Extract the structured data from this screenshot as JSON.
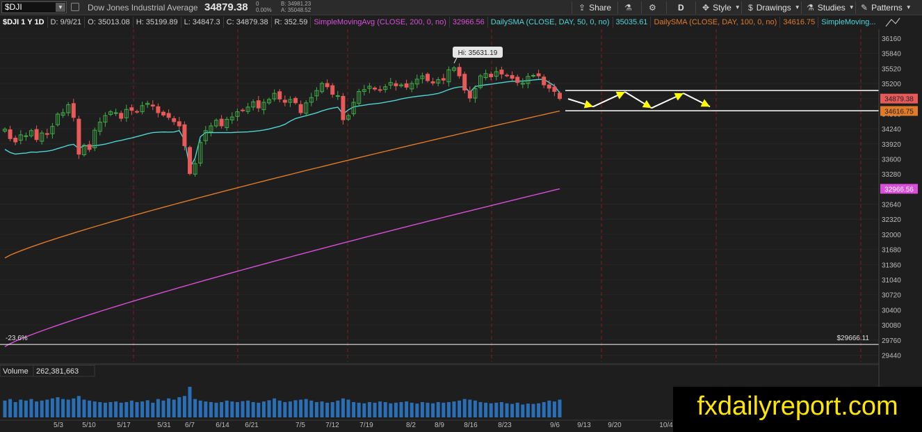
{
  "toolbar": {
    "symbol": "$DJI",
    "name": "Dow Jones Industrial Average",
    "last": "34879.38",
    "change": "0",
    "change_pct": "0.00%",
    "bid": "B: 34981.23",
    "ask": "A: 35048.52",
    "share_label": "Share",
    "aggregation": "D",
    "style_label": "Style",
    "drawings_label": "Drawings",
    "studies_label": "Studies",
    "patterns_label": "Patterns"
  },
  "study_line": {
    "symbol_period": "$DJI 1 Y 1D",
    "date": "D: 9/9/21",
    "open": "O: 35013.08",
    "high": "H: 35199.89",
    "low": "L: 34847.3",
    "close": "C: 34879.38",
    "range": "R: 352.59",
    "sma200_label": "SimpleMovingAvg (CLOSE, 200, 0, no)",
    "sma200_value": "32966.56",
    "sma50_label": "DailySMA (CLOSE, DAY, 50, 0, no)",
    "sma50_value": "35035.61",
    "sma100_label": "DailySMA (CLOSE, DAY, 100, 0, no)",
    "sma100_value": "34616.75",
    "more_label": "SimpleMoving..."
  },
  "volume_panel": {
    "label": "Volume",
    "value": "262,381,663"
  },
  "annotations": {
    "hi_bubble": "Hi: 35631.19",
    "fib_label": "-23.6%",
    "fib_price": "$29666.11"
  },
  "price_tags": {
    "last": "34879.38",
    "sma100": "34616.75",
    "sma200": "32966.56"
  },
  "colors": {
    "up_candle": "#3fae49",
    "down_candle": "#e85a5a",
    "sma50": "#4fd5d5",
    "sma100": "#e07b2a",
    "sma200": "#d94fd9",
    "volume": "#2a6fb5",
    "drawn_arrow": "#ffff00",
    "watermark_text": "#ffe600"
  },
  "watermark": "fxdailyreport.com",
  "chart_data": {
    "type": "candlestick",
    "y_axis_ticks": [
      "36160",
      "35840",
      "35520",
      "35200",
      "34880",
      "34560",
      "34240",
      "33920",
      "33600",
      "33280",
      "32960",
      "32640",
      "32320",
      "32000",
      "31680",
      "31360",
      "31040",
      "30720",
      "30400",
      "30080",
      "29760",
      "29440"
    ],
    "x_axis_ticks": [
      "5/3",
      "5/10",
      "5/17",
      "5/31",
      "6/7",
      "6/14",
      "6/21",
      "7/5",
      "7/12",
      "7/19",
      "8/2",
      "8/9",
      "8/16",
      "8/23",
      "9/6",
      "9/13",
      "9/20",
      "10/4"
    ],
    "ylim": [
      29300,
      36350
    ],
    "high": 35631.19,
    "sma50_last": 35035.61,
    "sma100_last": 34616.75,
    "sma200_last": 32966.56,
    "fib_level": 29666.11,
    "close": [
      34230,
      34030,
      33960,
      34110,
      34090,
      34200,
      34010,
      34150,
      34120,
      34290,
      34550,
      34580,
      34750,
      34480,
      33700,
      33890,
      33800,
      34210,
      34380,
      34520,
      34600,
      34580,
      34460,
      34650,
      34630,
      34600,
      34730,
      34780,
      34720,
      34580,
      34530,
      34480,
      34390,
      34300,
      33880,
      33290,
      33500,
      33950,
      34200,
      34300,
      34420,
      34300,
      34440,
      34490,
      34600,
      34630,
      34700,
      34810,
      34680,
      34800,
      34860,
      34990,
      34870,
      34800,
      34860,
      34790,
      34580,
      34790,
      34900,
      35050,
      35200,
      35130,
      34970,
      34940,
      34430,
      34520,
      34800,
      35030,
      35070,
      35140,
      35080,
      35060,
      35130,
      35220,
      35150,
      35170,
      35120,
      35200,
      35290,
      35360,
      35260,
      35210,
      35280,
      35270,
      35490,
      35530,
      35360,
      35060,
      34890,
      35090,
      35360,
      35410,
      35340,
      35450,
      35400,
      35370,
      35310,
      35220,
      35210,
      35350,
      35370,
      35360,
      35170,
      35100,
      35030,
      34880
    ],
    "volume_levels": [
      0.55,
      0.6,
      0.5,
      0.58,
      0.55,
      0.6,
      0.52,
      0.55,
      0.58,
      0.62,
      0.66,
      0.6,
      0.58,
      0.62,
      0.7,
      0.58,
      0.55,
      0.52,
      0.5,
      0.48,
      0.5,
      0.52,
      0.48,
      0.5,
      0.55,
      0.5,
      0.52,
      0.56,
      0.48,
      0.6,
      0.55,
      0.62,
      0.58,
      0.66,
      0.7,
      1.0,
      0.6,
      0.55,
      0.52,
      0.5,
      0.48,
      0.5,
      0.55,
      0.52,
      0.5,
      0.53,
      0.55,
      0.5,
      0.48,
      0.52,
      0.56,
      0.62,
      0.55,
      0.5,
      0.52,
      0.56,
      0.58,
      0.6,
      0.55,
      0.5,
      0.52,
      0.48,
      0.5,
      0.55,
      0.62,
      0.58,
      0.5,
      0.48,
      0.46,
      0.5,
      0.48,
      0.52,
      0.5,
      0.46,
      0.48,
      0.5,
      0.52,
      0.48,
      0.45,
      0.5,
      0.48,
      0.46,
      0.5,
      0.48,
      0.5,
      0.52,
      0.55,
      0.6,
      0.58,
      0.55,
      0.5,
      0.48,
      0.46,
      0.48,
      0.5,
      0.46,
      0.44,
      0.48,
      0.42,
      0.45,
      0.44,
      0.46,
      0.5,
      0.55,
      0.52,
      0.58
    ]
  }
}
